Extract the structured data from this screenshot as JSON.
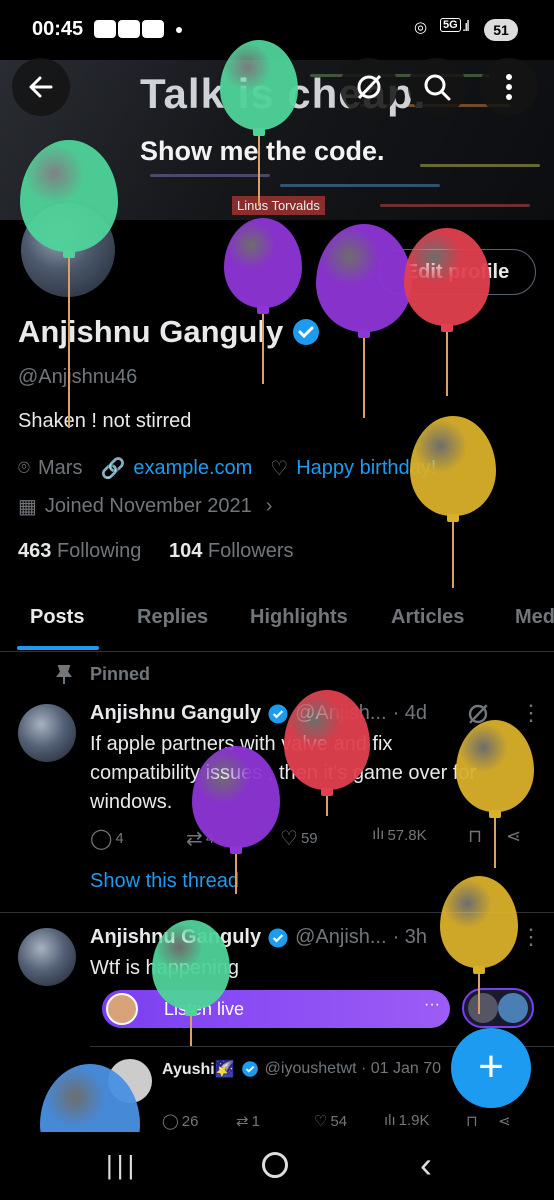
{
  "status_bar": {
    "time": "00:45",
    "network": "5G",
    "battery": "51"
  },
  "banner": {
    "title": "Talk is cheap.",
    "subtitle": "Show me the code.",
    "credit": "Linus Torvalds"
  },
  "header": {
    "back_icon": "back-arrow-icon",
    "grok_icon": "grok-icon",
    "search_icon": "search-icon",
    "more_icon": "more-vertical-icon"
  },
  "profile": {
    "name": "Anjishnu Ganguly",
    "handle": "@Anjishnu46",
    "bio": "Shaken ! not stirred",
    "location": "Mars",
    "website": "example.com",
    "birthday": "Happy birthday!",
    "joined": "Joined November 2021",
    "following_count": "463",
    "following_label": "Following",
    "followers_count": "104",
    "followers_label": "Followers",
    "edit_label": "Edit profile"
  },
  "tabs": [
    {
      "label": "Posts"
    },
    {
      "label": "Replies"
    },
    {
      "label": "Highlights"
    },
    {
      "label": "Articles"
    },
    {
      "label": "Media"
    }
  ],
  "posts": [
    {
      "pinned_label": "Pinned",
      "author": "Anjishnu Ganguly",
      "handle": "@Anjish...",
      "time": "· 4d",
      "text_lines": [
        "If apple partners with valve and fix",
        "compatibility issues , then it's game over for",
        "windows."
      ],
      "replies": "4",
      "reposts": "4",
      "likes": "59",
      "views": "57.8K",
      "show_thread": "Show this thread"
    },
    {
      "author": "Anjishnu Ganguly",
      "handle": "@Anjish...",
      "time": "· 3h",
      "text": "Wtf is happening",
      "space_label": "Listen live",
      "quote": {
        "author": "Ayushi🌠",
        "handle": "@iyoushetwt · 01 Jan 70"
      },
      "replies": "26",
      "reposts": "1",
      "likes": "54",
      "views": "1.9K"
    }
  ],
  "fab": {
    "label": "+"
  },
  "colors": {
    "accent": "#1d9bf0",
    "verified": "#1d9bf0",
    "space": "#8b4cf4"
  },
  "balloon_colors": [
    "#4fd39a",
    "#4fd39a",
    "#8d35d6",
    "#8d35d6",
    "#e0404f",
    "#d9b02a",
    "#e0404f",
    "#8d35d6",
    "#d9b02a",
    "#4fd39a",
    "#d9b02a",
    "#4a90e2"
  ]
}
